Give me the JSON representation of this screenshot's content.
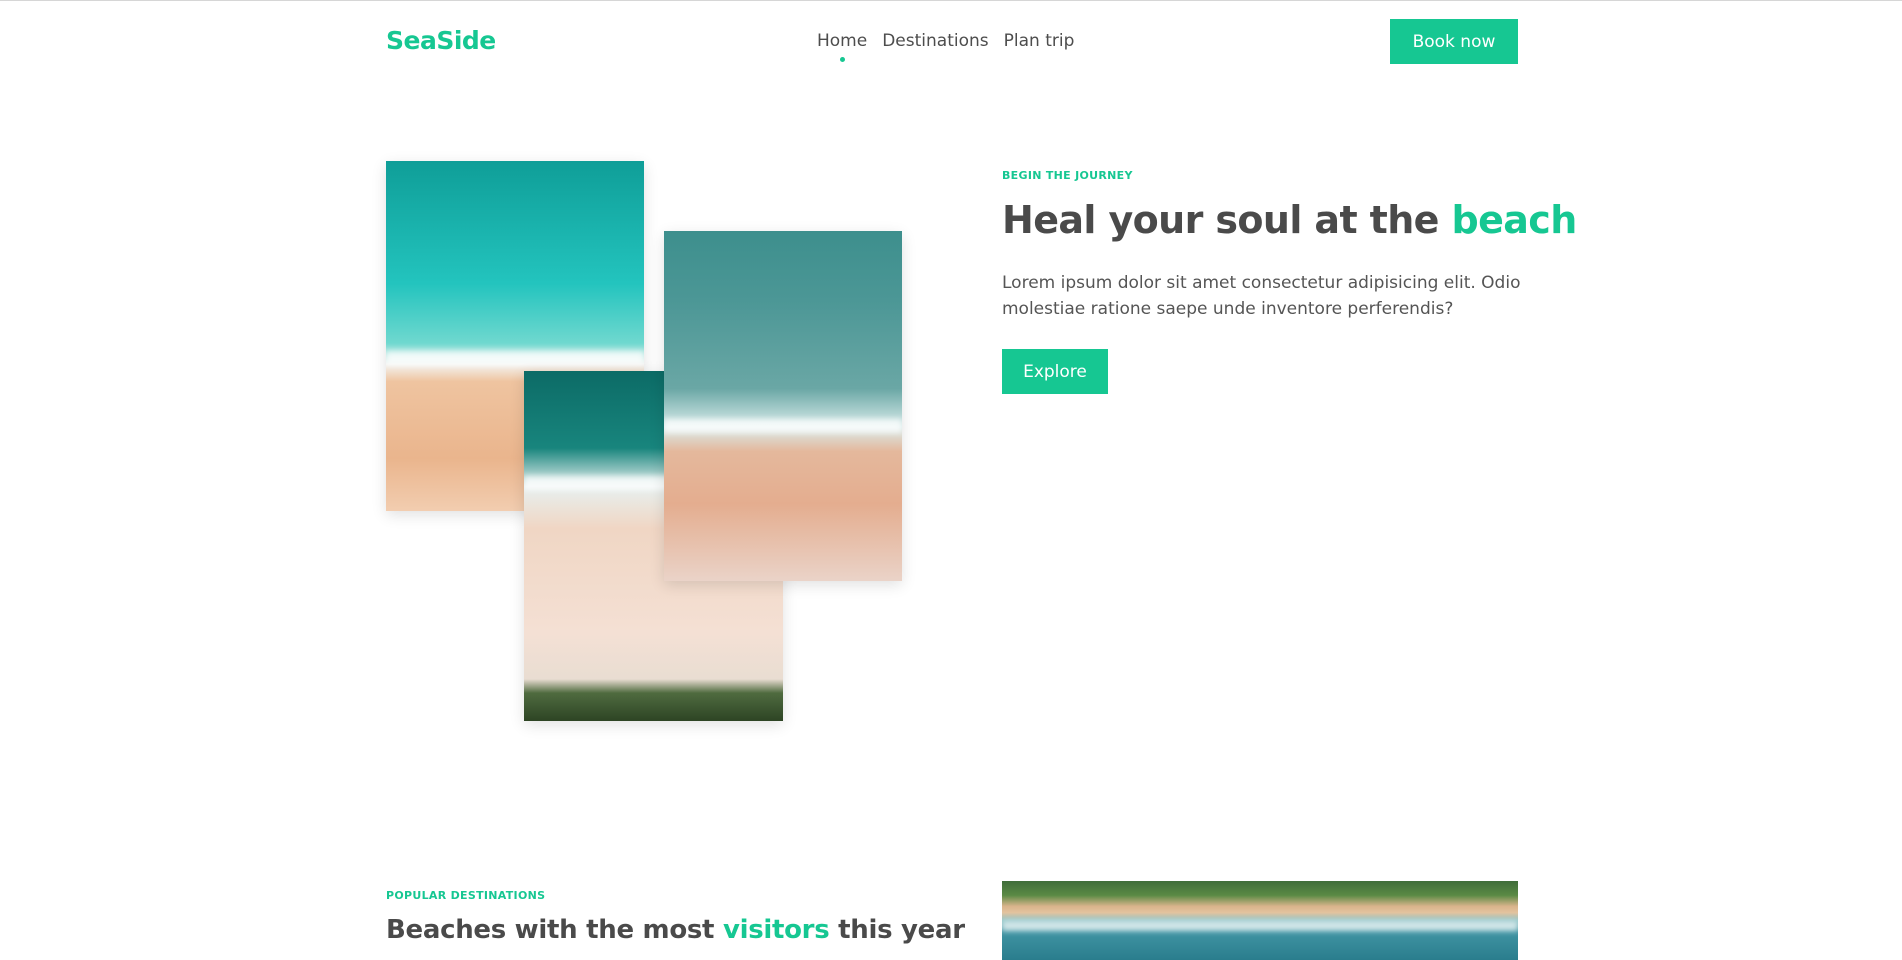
{
  "header": {
    "logo": "SeaSide",
    "nav": [
      {
        "label": "Home",
        "active": true
      },
      {
        "label": "Destinations",
        "active": false
      },
      {
        "label": "Plan trip",
        "active": false
      }
    ],
    "book_button": "Book now"
  },
  "hero": {
    "eyebrow": "BEGIN THE JOURNEY",
    "title_part1": "Heal your soul at the ",
    "title_accent": "beach",
    "text": "Lorem ipsum dolor sit amet consectetur adipisicing elit. Odio molestiae ratione saepe unde inventore perferendis?",
    "explore_button": "Explore"
  },
  "popular": {
    "eyebrow": "POPULAR DESTINATIONS",
    "title_part1": "Beaches with the most ",
    "title_accent": "visitors",
    "title_part2": " this year"
  },
  "colors": {
    "accent": "#16c792",
    "text": "#4a4a4a"
  }
}
